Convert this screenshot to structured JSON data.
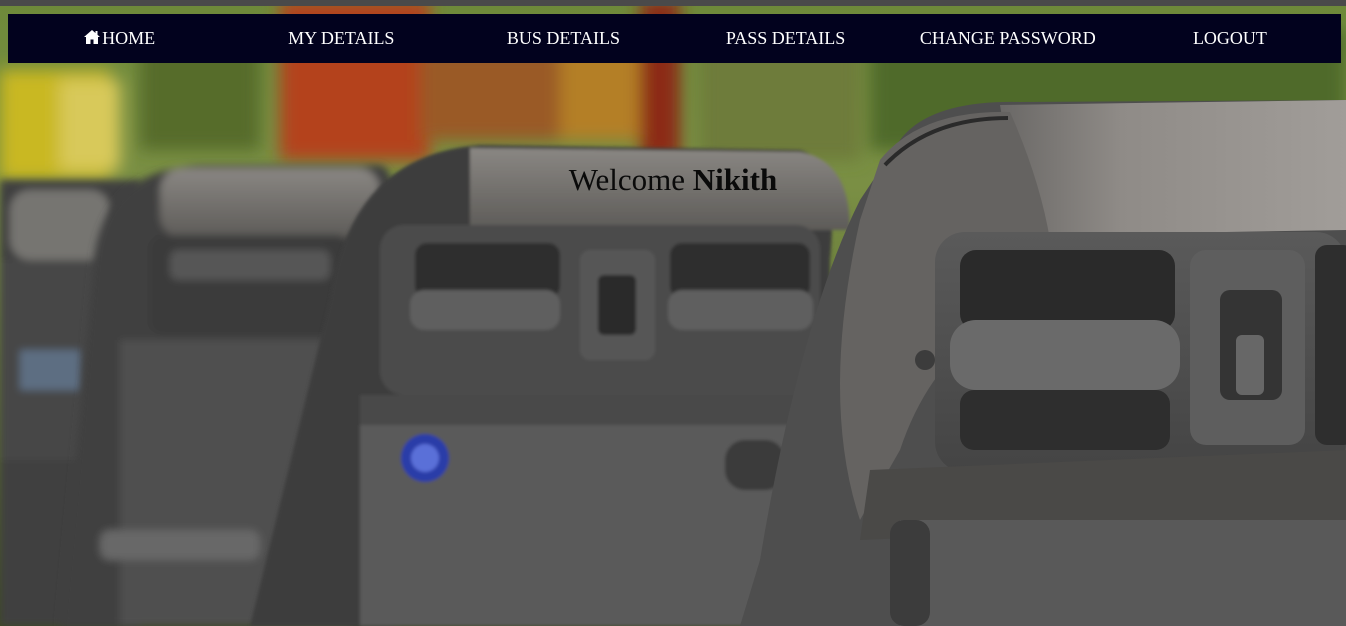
{
  "nav": {
    "items": [
      {
        "label": "HOME",
        "icon": "home-icon"
      },
      {
        "label": "MY DETAILS"
      },
      {
        "label": "BUS DETAILS"
      },
      {
        "label": "PASS DETAILS"
      },
      {
        "label": "CHANGE PASSWORD"
      },
      {
        "label": "LOGOUT"
      }
    ]
  },
  "welcome": {
    "prefix": "Welcome",
    "user": "Nikith"
  },
  "colors": {
    "navbar_bg": "#02021e",
    "nav_text": "#ffffff",
    "welcome_text": "#0a0a0a"
  }
}
